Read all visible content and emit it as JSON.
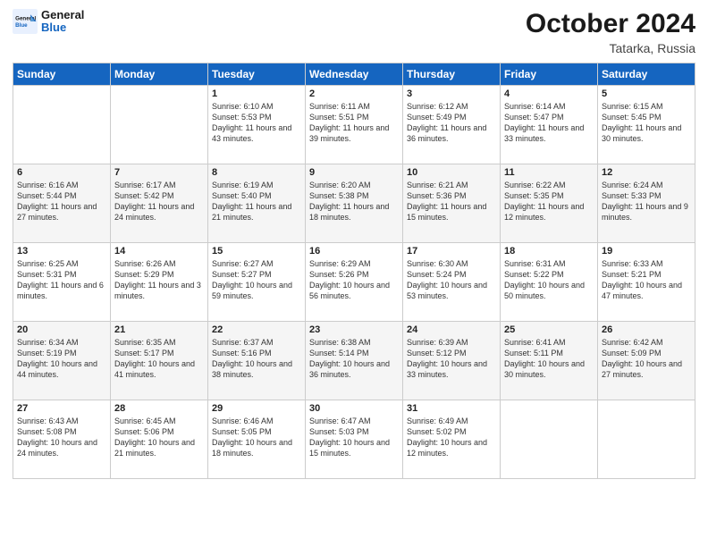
{
  "header": {
    "logo_general": "General",
    "logo_blue": "Blue",
    "month_title": "October 2024",
    "location": "Tatarka, Russia"
  },
  "days_of_week": [
    "Sunday",
    "Monday",
    "Tuesday",
    "Wednesday",
    "Thursday",
    "Friday",
    "Saturday"
  ],
  "weeks": [
    [
      {
        "day": "",
        "text": ""
      },
      {
        "day": "",
        "text": ""
      },
      {
        "day": "1",
        "text": "Sunrise: 6:10 AM\nSunset: 5:53 PM\nDaylight: 11 hours and 43 minutes."
      },
      {
        "day": "2",
        "text": "Sunrise: 6:11 AM\nSunset: 5:51 PM\nDaylight: 11 hours and 39 minutes."
      },
      {
        "day": "3",
        "text": "Sunrise: 6:12 AM\nSunset: 5:49 PM\nDaylight: 11 hours and 36 minutes."
      },
      {
        "day": "4",
        "text": "Sunrise: 6:14 AM\nSunset: 5:47 PM\nDaylight: 11 hours and 33 minutes."
      },
      {
        "day": "5",
        "text": "Sunrise: 6:15 AM\nSunset: 5:45 PM\nDaylight: 11 hours and 30 minutes."
      }
    ],
    [
      {
        "day": "6",
        "text": "Sunrise: 6:16 AM\nSunset: 5:44 PM\nDaylight: 11 hours and 27 minutes."
      },
      {
        "day": "7",
        "text": "Sunrise: 6:17 AM\nSunset: 5:42 PM\nDaylight: 11 hours and 24 minutes."
      },
      {
        "day": "8",
        "text": "Sunrise: 6:19 AM\nSunset: 5:40 PM\nDaylight: 11 hours and 21 minutes."
      },
      {
        "day": "9",
        "text": "Sunrise: 6:20 AM\nSunset: 5:38 PM\nDaylight: 11 hours and 18 minutes."
      },
      {
        "day": "10",
        "text": "Sunrise: 6:21 AM\nSunset: 5:36 PM\nDaylight: 11 hours and 15 minutes."
      },
      {
        "day": "11",
        "text": "Sunrise: 6:22 AM\nSunset: 5:35 PM\nDaylight: 11 hours and 12 minutes."
      },
      {
        "day": "12",
        "text": "Sunrise: 6:24 AM\nSunset: 5:33 PM\nDaylight: 11 hours and 9 minutes."
      }
    ],
    [
      {
        "day": "13",
        "text": "Sunrise: 6:25 AM\nSunset: 5:31 PM\nDaylight: 11 hours and 6 minutes."
      },
      {
        "day": "14",
        "text": "Sunrise: 6:26 AM\nSunset: 5:29 PM\nDaylight: 11 hours and 3 minutes."
      },
      {
        "day": "15",
        "text": "Sunrise: 6:27 AM\nSunset: 5:27 PM\nDaylight: 10 hours and 59 minutes."
      },
      {
        "day": "16",
        "text": "Sunrise: 6:29 AM\nSunset: 5:26 PM\nDaylight: 10 hours and 56 minutes."
      },
      {
        "day": "17",
        "text": "Sunrise: 6:30 AM\nSunset: 5:24 PM\nDaylight: 10 hours and 53 minutes."
      },
      {
        "day": "18",
        "text": "Sunrise: 6:31 AM\nSunset: 5:22 PM\nDaylight: 10 hours and 50 minutes."
      },
      {
        "day": "19",
        "text": "Sunrise: 6:33 AM\nSunset: 5:21 PM\nDaylight: 10 hours and 47 minutes."
      }
    ],
    [
      {
        "day": "20",
        "text": "Sunrise: 6:34 AM\nSunset: 5:19 PM\nDaylight: 10 hours and 44 minutes."
      },
      {
        "day": "21",
        "text": "Sunrise: 6:35 AM\nSunset: 5:17 PM\nDaylight: 10 hours and 41 minutes."
      },
      {
        "day": "22",
        "text": "Sunrise: 6:37 AM\nSunset: 5:16 PM\nDaylight: 10 hours and 38 minutes."
      },
      {
        "day": "23",
        "text": "Sunrise: 6:38 AM\nSunset: 5:14 PM\nDaylight: 10 hours and 36 minutes."
      },
      {
        "day": "24",
        "text": "Sunrise: 6:39 AM\nSunset: 5:12 PM\nDaylight: 10 hours and 33 minutes."
      },
      {
        "day": "25",
        "text": "Sunrise: 6:41 AM\nSunset: 5:11 PM\nDaylight: 10 hours and 30 minutes."
      },
      {
        "day": "26",
        "text": "Sunrise: 6:42 AM\nSunset: 5:09 PM\nDaylight: 10 hours and 27 minutes."
      }
    ],
    [
      {
        "day": "27",
        "text": "Sunrise: 6:43 AM\nSunset: 5:08 PM\nDaylight: 10 hours and 24 minutes."
      },
      {
        "day": "28",
        "text": "Sunrise: 6:45 AM\nSunset: 5:06 PM\nDaylight: 10 hours and 21 minutes."
      },
      {
        "day": "29",
        "text": "Sunrise: 6:46 AM\nSunset: 5:05 PM\nDaylight: 10 hours and 18 minutes."
      },
      {
        "day": "30",
        "text": "Sunrise: 6:47 AM\nSunset: 5:03 PM\nDaylight: 10 hours and 15 minutes."
      },
      {
        "day": "31",
        "text": "Sunrise: 6:49 AM\nSunset: 5:02 PM\nDaylight: 10 hours and 12 minutes."
      },
      {
        "day": "",
        "text": ""
      },
      {
        "day": "",
        "text": ""
      }
    ]
  ]
}
